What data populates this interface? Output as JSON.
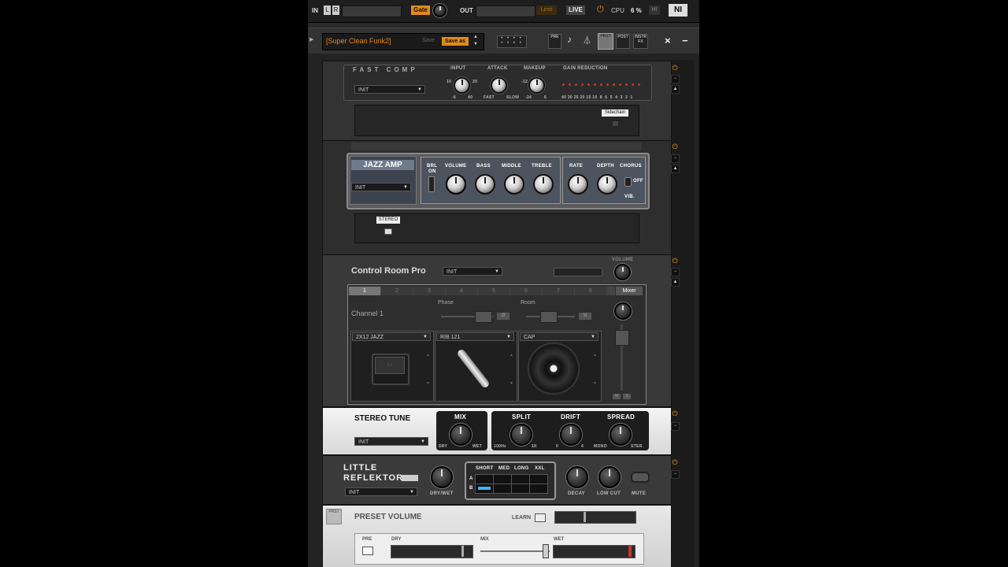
{
  "topbar": {
    "in_label": "IN",
    "l_label": "L",
    "r_label": "R",
    "gate_label": "Gate",
    "out_label": "OUT",
    "limit_label": "Limit",
    "live_label": "LIVE",
    "cpu_label": "CPU",
    "cpu_value": "6 %",
    "hi_label": "HI",
    "ni_logo": "NI"
  },
  "presetbar": {
    "preset_name": "[Super Clean Funk2]",
    "save_label": "Save",
    "save_as_label": "Save as",
    "pre_label": "PRE",
    "post_label": "POST",
    "instr_label": "INSTR FX",
    "close": "×",
    "minimize": "−"
  },
  "fastcomp": {
    "title": "FAST COMP",
    "preset": "INIT",
    "input_label": "INPUT",
    "attack_label": "ATTACK",
    "makeup_label": "MAKEUP",
    "gain_reduction_label": "GAIN REDUCTION",
    "input_min": "-6",
    "input_max": "40",
    "input_top_l": "10",
    "input_top_r": "20",
    "attack_min": "FAST",
    "attack_max": "SLOW",
    "makeup_min": "-24",
    "makeup_max": "6",
    "makeup_top": "-12",
    "gr_scale": "40 30 25 20 15 10  8  6  5  4  3  2  1",
    "sidechain_label": "Sidechain"
  },
  "jazzamp": {
    "title": "JAZZ AMP",
    "preset": "INIT",
    "brl_label": "BRL",
    "on_label": "ON",
    "volume_label": "VOLUME",
    "bass_label": "BASS",
    "middle_label": "MIDDLE",
    "treble_label": "TREBLE",
    "rate_label": "RATE",
    "depth_label": "DEPTH",
    "chorus_label": "CHORUS",
    "off_label": "OFF",
    "vib_label": "VIB.",
    "stereo_label": "STEREO"
  },
  "controlroom": {
    "title": "Control Room Pro",
    "preset": "INIT",
    "volume_label": "VOLUME",
    "tabs": [
      "1",
      "2",
      "3",
      "4",
      "5",
      "6",
      "7",
      "8"
    ],
    "mixer_tab": "Mixer",
    "channel_label": "Channel 1",
    "phase_label": "Phase",
    "room_label": "Room",
    "phase_btn": "Ø",
    "room_btn": "M",
    "cab_select": "2X12 JAZZ",
    "mic_select": "RIB 121",
    "position_select": "CAP",
    "m_label": "M",
    "s_label": "S"
  },
  "stereotune": {
    "title": "STEREO TUNE",
    "preset": "INIT",
    "mix_label": "MIX",
    "mix_min": "DRY",
    "mix_max": "WET",
    "split_label": "SPLIT",
    "split_min": "100Hz",
    "split_max": "1K",
    "drift_label": "DRIFT",
    "drift_min": "0",
    "drift_max": "4",
    "spread_label": "SPREAD",
    "spread_min": "MONO",
    "spread_max": "STER."
  },
  "reflektor": {
    "title_line1": "LITTLE",
    "title_line2": "REFLEKTOR",
    "preset": "INIT",
    "drywet_label": "DRY/WET",
    "short_label": "SHORT",
    "med_label": "MED",
    "long_label": "LONG",
    "xxl_label": "XXL",
    "a_label": "A",
    "b_label": "B",
    "decay_label": "DECAY",
    "lowcut_label": "LOW CUT",
    "mute_label": "MUTE"
  },
  "presetvolume": {
    "badge": "PRST",
    "title": "PRESET VOLUME",
    "learn_label": "LEARN",
    "pre_label": "PRE",
    "dry_label": "DRY",
    "mix_label": "MIX",
    "wet_label": "WET"
  },
  "colors": {
    "accent_orange": "#e08a1e",
    "accent_blue": "#3fb6e8",
    "led_red": "#c0392b"
  }
}
